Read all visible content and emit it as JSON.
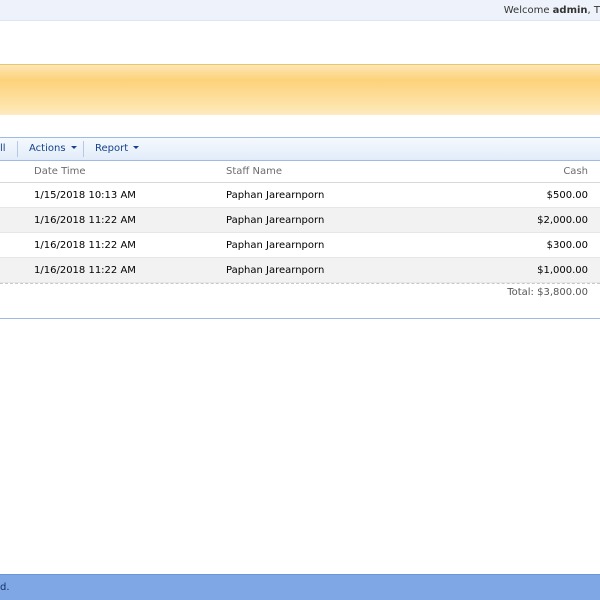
{
  "header": {
    "welcome_prefix": "Welcome ",
    "welcome_user": "admin",
    "welcome_suffix": ", T"
  },
  "toolbar": {
    "cut_item": "ll",
    "actions_label": "Actions",
    "report_label": "Report"
  },
  "table": {
    "columns": {
      "date_time": "Date Time",
      "staff_name": "Staff Name",
      "cash": "Cash"
    },
    "rows": [
      {
        "date_time": "1/15/2018 10:13 AM",
        "staff_name": "Paphan Jarearnporn",
        "cash": "$500.00"
      },
      {
        "date_time": "1/16/2018 11:22 AM",
        "staff_name": "Paphan Jarearnporn",
        "cash": "$2,000.00"
      },
      {
        "date_time": "1/16/2018 11:22 AM",
        "staff_name": "Paphan Jarearnporn",
        "cash": "$300.00"
      },
      {
        "date_time": "1/16/2018 11:22 AM",
        "staff_name": "Paphan Jarearnporn",
        "cash": "$1,000.00"
      }
    ],
    "total": "Total: $3,800.00"
  },
  "footer": {
    "text": "d."
  },
  "colors": {
    "banner": "#fdd27a",
    "toolbar_border": "#9fbbe3",
    "footer": "#7fa7e6",
    "link": "#15428b"
  }
}
